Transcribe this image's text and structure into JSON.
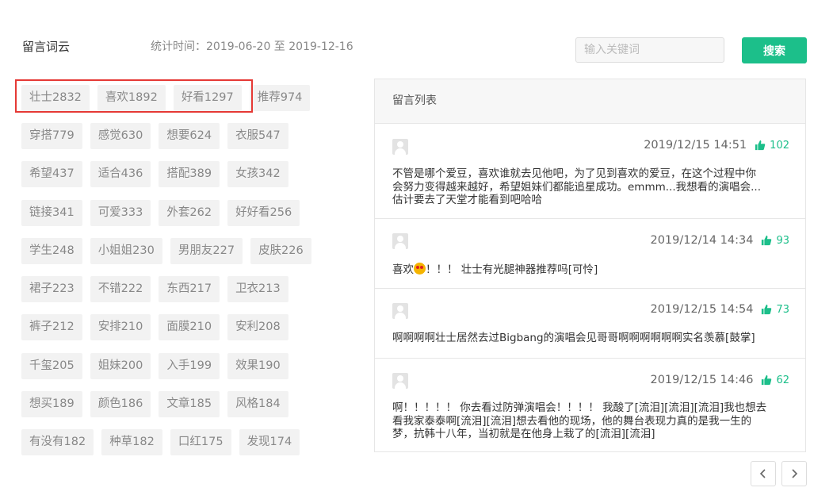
{
  "header": {
    "title": "留言词云",
    "stat": "统计时间：2019-06-20 至 2019-12-16"
  },
  "search": {
    "placeholder": "输入关键词",
    "button": "搜索"
  },
  "cloud": {
    "rows": [
      [
        "壮士2832",
        "喜欢1892",
        "好看1297",
        "推荐974"
      ],
      [
        "穿搭779",
        "感觉630",
        "想要624",
        "衣服547"
      ],
      [
        "希望437",
        "适合436",
        "搭配389",
        "女孩342"
      ],
      [
        "链接341",
        "可爱333",
        "外套262",
        "好好看256"
      ],
      [
        "学生248",
        "小姐姐230",
        "男朋友227",
        "皮肤226"
      ],
      [
        "裙子223",
        "不错222",
        "东西217",
        "卫衣213"
      ],
      [
        "裤子212",
        "安排210",
        "面膜210",
        "安利208"
      ],
      [
        "千玺205",
        "姐妹200",
        "入手199",
        "效果190"
      ],
      [
        "想买189",
        "颜色186",
        "文章185",
        "风格184"
      ],
      [
        "有没有182",
        "种草182",
        "口红175",
        "发现174"
      ]
    ]
  },
  "messages": {
    "title": "留言列表",
    "items": [
      {
        "time": "2019/12/15 14:51",
        "likes": "102",
        "lines": [
          "不管是哪个爱豆，喜欢谁就去见他吧，为了见到喜欢的爱豆，在这个过程中你",
          "会努力变得越来越好，希望姐妹们都能追星成功。emmm...我想看的演唱会...",
          "估计要去了天堂才能看到吧哈哈"
        ]
      },
      {
        "time": "2019/12/14 14:34",
        "likes": "93",
        "text_before": "喜欢",
        "text_after": "！！！ 壮士有光腿神器推荐吗[可怜]"
      },
      {
        "time": "2019/12/15 14:54",
        "likes": "73",
        "lines": [
          "啊啊啊啊壮士居然去过Bigbang的演唱会见哥哥啊啊啊啊啊啊实名羡慕[鼓掌]"
        ]
      },
      {
        "time": "2019/12/15 14:46",
        "likes": "62",
        "lines": [
          "啊！！！！！ 你去看过防弹演唱会！！！！ 我酸了[流泪][流泪][流泪]我也想去",
          "看我家泰泰啊[流泪][流泪]想去看他的现场，他的舞台表现力真的是我一生的",
          "梦，抗韩十八年，当初就是在他身上栽了的[流泪][流泪]"
        ]
      }
    ]
  }
}
